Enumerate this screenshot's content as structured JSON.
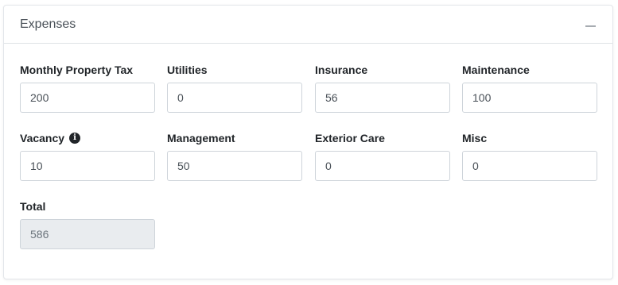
{
  "panel": {
    "title": "Expenses"
  },
  "fields": [
    {
      "label": "Monthly Property Tax",
      "value": "200"
    },
    {
      "label": "Utilities",
      "value": "0"
    },
    {
      "label": "Insurance",
      "value": "56"
    },
    {
      "label": "Maintenance",
      "value": "100"
    },
    {
      "label": "Vacancy",
      "value": "10",
      "icon": "info-icon"
    },
    {
      "label": "Management",
      "value": "50"
    },
    {
      "label": "Exterior Care",
      "value": "0"
    },
    {
      "label": "Misc",
      "value": "0"
    }
  ],
  "total": {
    "label": "Total",
    "value": "586"
  }
}
